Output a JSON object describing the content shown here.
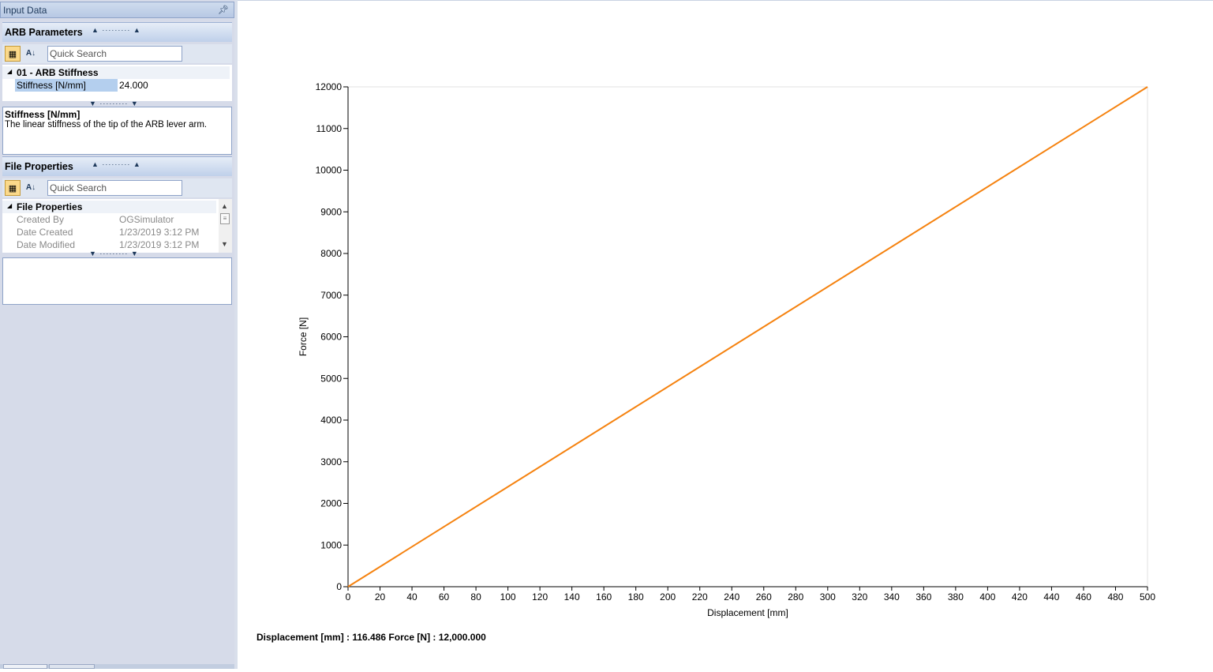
{
  "panel": {
    "title": "Input Data",
    "pin_icon": "pin-icon"
  },
  "arb_section": {
    "title": "ARB Parameters",
    "search_placeholder": "Quick Search",
    "category": "01 - ARB Stiffness",
    "rows": [
      {
        "name": "Stiffness [N/mm]",
        "value": "24.000"
      }
    ],
    "description": {
      "title": "Stiffness [N/mm]",
      "text": "The linear stiffness of the tip of the ARB lever arm."
    }
  },
  "file_section": {
    "title": "File Properties",
    "search_placeholder": "Quick Search",
    "category": "File Properties",
    "rows": [
      {
        "name": "Created By",
        "value": "OGSimulator"
      },
      {
        "name": "Date Created",
        "value": "1/23/2019 3:12 PM"
      },
      {
        "name": "Date Modified",
        "value": "1/23/2019 3:12 PM"
      }
    ]
  },
  "readout": "Displacement [mm] : 116.486 Force [N] : 12,000.000",
  "chart_data": {
    "type": "line",
    "xlabel": "Displacement [mm]",
    "ylabel": "Force [N]",
    "xlim": [
      0,
      500
    ],
    "ylim": [
      0,
      12000
    ],
    "xticks": [
      0,
      20,
      40,
      60,
      80,
      100,
      120,
      140,
      160,
      180,
      200,
      220,
      240,
      260,
      280,
      300,
      320,
      340,
      360,
      380,
      400,
      420,
      440,
      460,
      480,
      500
    ],
    "yticks": [
      0,
      1000,
      2000,
      3000,
      4000,
      5000,
      6000,
      7000,
      8000,
      9000,
      10000,
      11000,
      12000
    ],
    "series": [
      {
        "color": "#f5820f",
        "x": [
          0,
          500
        ],
        "y": [
          0,
          12000
        ]
      }
    ],
    "grid": false
  }
}
